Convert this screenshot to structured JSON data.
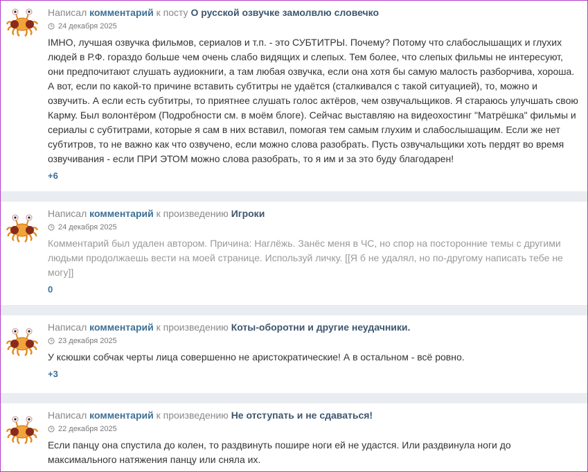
{
  "labels": {
    "wrote": "Написал",
    "comment": "комментарий"
  },
  "comments": [
    {
      "target_prefix": "к посту",
      "title": "О русской озвучке замолвлю словечко",
      "date": "24 декабря 2025",
      "text": "IMHO, лучшая озвучка фильмов, сериалов и т.п. - это СУБТИТРЫ. Почему? Потому что слабослышащих и глухих людей в Р.Ф. гораздо больше чем очень слабо видящих и слепых. Тем более, что слепых фильмы не интересуют, они предпочитают слушать аудиокниги, а там любая озвучка, если она хотя бы самую малость разборчива, хороша. А вот, если по какой-то причине вставить субтитры не удаётся (сталкивался с такой ситуацией), то, можно и озвучить. А если есть субтитры, то приятнее слушать голос актёров, чем озвучальщиков. Я стараюсь улучшать свою Карму. Был волонтёром (Подробности см. в моём блоге). Сейчас выставляю на видеохостинг \"Матрёшка\" фильмы и сериалы с субтитрами, которые я сам в них вставил, помогая тем самым глухим и слабослышащим. Если же нет субтитров, то не важно как что озвучено, если можно слова разобрать. Пусть озвучальщики хоть пердят во время озвучивания - если ПРИ ЭТОМ можно слова разобрать, то я им и за это буду благодарен!",
      "score": "+6"
    },
    {
      "target_prefix": "к произведению",
      "title": "Игроки",
      "date": "24 декабря 2025",
      "text": "Комментарий был удален автором. Причина: Наглёжь. Занёс меня в ЧС, но спор на посторонние темы с другими людьми продолжаешь вести на моей странице. Используй личку. [[Я б не удалял, но по-другому написать тебе не могу]]",
      "score": "0"
    },
    {
      "target_prefix": "к произведению",
      "title": "Коты-оборотни и другие неудачники.",
      "date": "23 декабря 2025",
      "text": "У ксюшки собчак черты лица совершенно не аристократические! А в остальном - всё ровно.",
      "score": "+3"
    },
    {
      "target_prefix": "к произведению",
      "title": "Не отступать и не сдаваться!",
      "date": "22 декабря 2025",
      "text": "Если панцу она спустила до колен, то раздвинуть пошире ноги ей не удастся. Или раздвинула ноги до максимального натяжения панцу или сняла их.",
      "score": ""
    }
  ]
}
